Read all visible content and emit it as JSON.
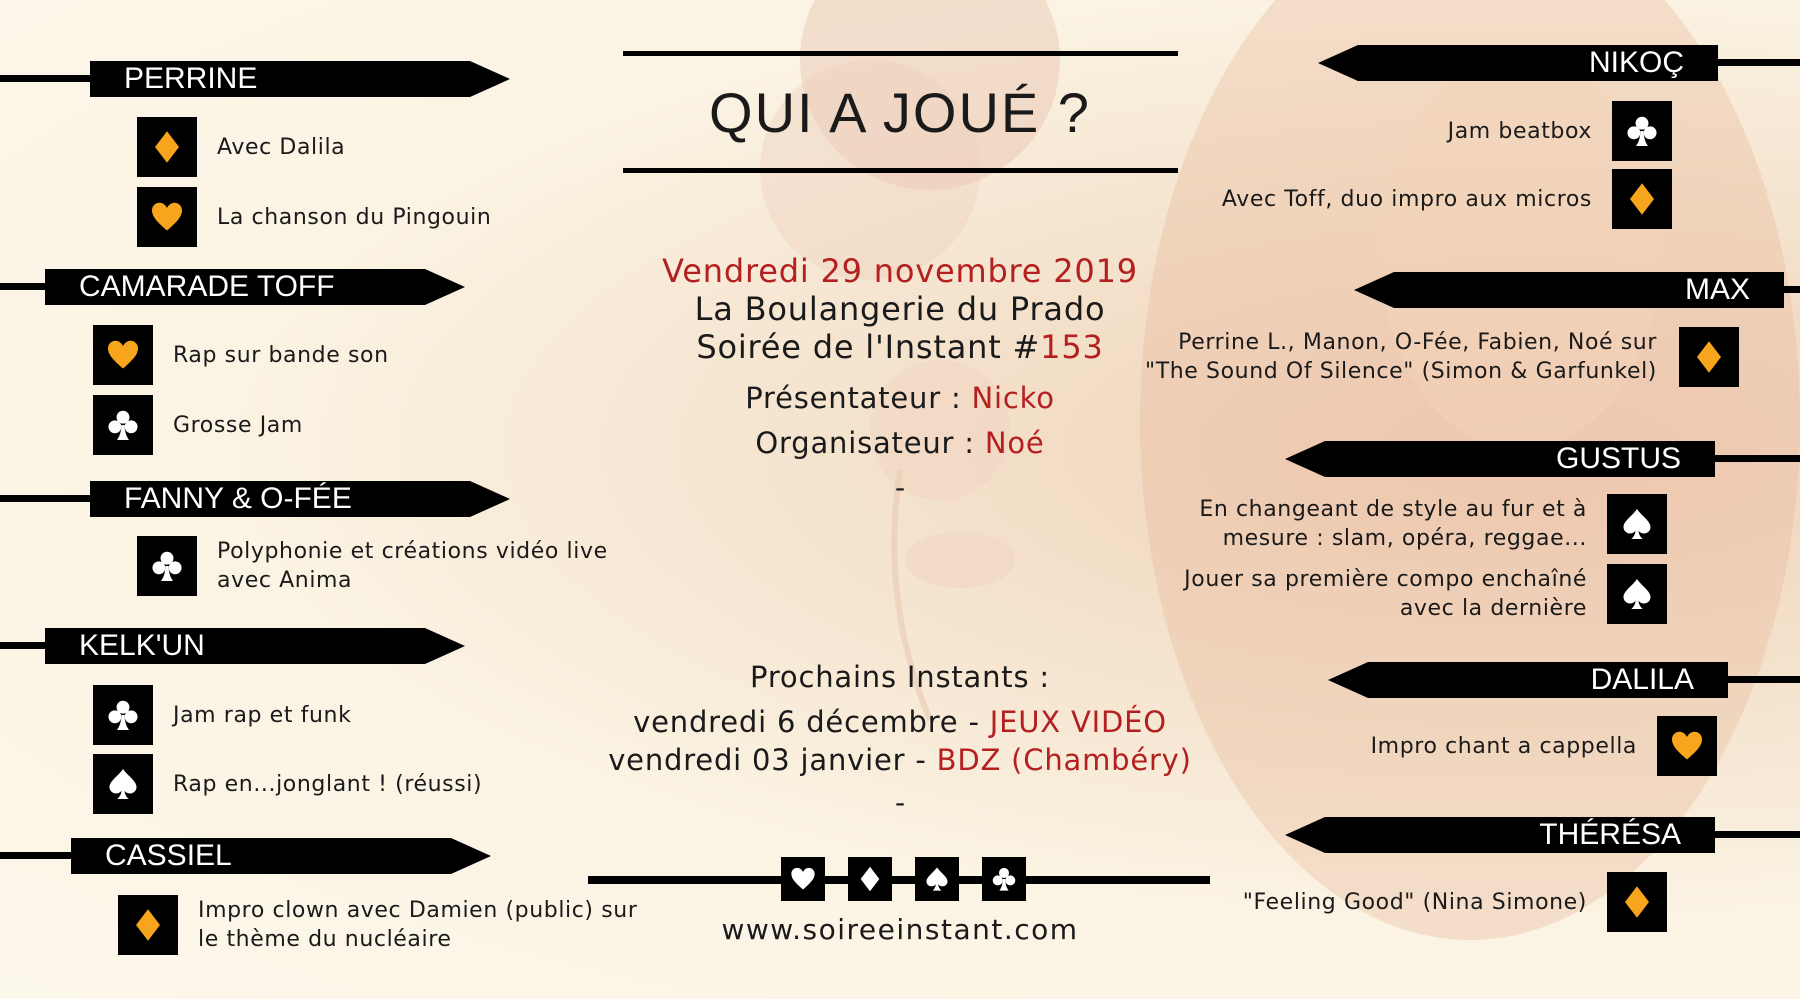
{
  "title": "QUI A JOUÉ ?",
  "event": {
    "date": "Vendredi 29 novembre 2019",
    "venue": "La Boulangerie du Prado",
    "soiree_prefix": "Soirée de l'Instant #",
    "soiree_number": "153",
    "presenter_label": "Présentateur : ",
    "presenter": "Nicko",
    "organizer_label": "Organisateur : ",
    "organizer": "Noé",
    "dash1": "-"
  },
  "next": {
    "heading": "Prochains Instants :",
    "items": [
      {
        "date": "vendredi 6 décembre - ",
        "name": "JEUX VIDÉO"
      },
      {
        "date": "vendredi 03 janvier - ",
        "name": "BDZ (Chambéry)"
      }
    ],
    "dash2": "-"
  },
  "website": "www.soireeinstant.com",
  "footer_suits": [
    "heart",
    "diamond",
    "spade",
    "club"
  ],
  "colors": {
    "accent": "#b3201f",
    "suit_orange": "#f7a51c",
    "banner": "#000000"
  },
  "left": [
    {
      "name": "PERRINE",
      "acts": [
        {
          "suit": "diamond",
          "text": [
            "Avec Dalila"
          ]
        },
        {
          "suit": "heart",
          "text": [
            "La chanson du Pingouin"
          ]
        }
      ]
    },
    {
      "name": "CAMARADE TOFF",
      "acts": [
        {
          "suit": "heart",
          "text": [
            "Rap sur bande son"
          ]
        },
        {
          "suit": "club",
          "text": [
            "Grosse Jam"
          ]
        }
      ]
    },
    {
      "name": "FANNY & O-FÉE",
      "acts": [
        {
          "suit": "club",
          "text": [
            "Polyphonie et créations vidéo live",
            "avec Anima"
          ]
        }
      ]
    },
    {
      "name": "KELK'UN",
      "acts": [
        {
          "suit": "club",
          "text": [
            "Jam rap et funk"
          ]
        },
        {
          "suit": "spade",
          "text": [
            "Rap en...jonglant ! (réussi)"
          ]
        }
      ]
    },
    {
      "name": "CASSIEL",
      "acts": [
        {
          "suit": "diamond",
          "text": [
            "Impro clown avec Damien (public) sur",
            "le thème du nucléaire"
          ]
        }
      ]
    }
  ],
  "right": [
    {
      "name": "NIKOÇ",
      "acts": [
        {
          "suit": "club",
          "text": [
            "Jam beatbox"
          ]
        },
        {
          "suit": "diamond",
          "text": [
            "Avec Toff, duo impro aux micros"
          ]
        }
      ]
    },
    {
      "name": "MAX",
      "acts": [
        {
          "suit": "diamond",
          "text": [
            "Perrine L., Manon, O-Fée, Fabien, Noé sur",
            "\"The Sound Of Silence\" (Simon & Garfunkel)"
          ]
        }
      ]
    },
    {
      "name": "GUSTUS",
      "acts": [
        {
          "suit": "spade",
          "text": [
            "En changeant de style au fur et à",
            "mesure : slam, opéra, reggae..."
          ]
        },
        {
          "suit": "spade",
          "text": [
            "Jouer sa première compo enchaîné",
            "avec la dernière"
          ]
        }
      ]
    },
    {
      "name": "DALILA",
      "acts": [
        {
          "suit": "heart",
          "text": [
            "Impro chant a cappella"
          ]
        }
      ]
    },
    {
      "name": "THÉRÉSA",
      "acts": [
        {
          "suit": "diamond",
          "text": [
            "\"Feeling Good\" (Nina Simone)"
          ]
        }
      ]
    }
  ]
}
